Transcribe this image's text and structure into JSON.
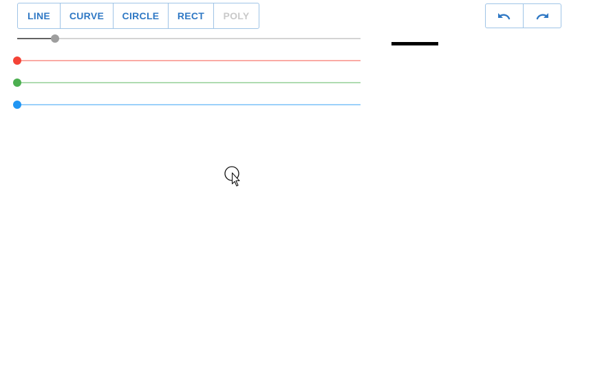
{
  "toolbar": {
    "tools": [
      {
        "key": "line",
        "label": "LINE",
        "enabled": true
      },
      {
        "key": "curve",
        "label": "CURVE",
        "enabled": true
      },
      {
        "key": "circle",
        "label": "CIRCLE",
        "enabled": true
      },
      {
        "key": "rect",
        "label": "RECT",
        "enabled": true
      },
      {
        "key": "poly",
        "label": "POLY",
        "enabled": false
      }
    ],
    "history": {
      "undo_icon": "undo-arrow-icon",
      "redo_icon": "redo-arrow-icon",
      "icon_color": "#2f78c4"
    }
  },
  "sliders": {
    "stroke_width": {
      "value": 0.11,
      "color": "#9e9e9e",
      "track_color": "#616161"
    },
    "red": {
      "value": 0,
      "color": "#f44336"
    },
    "green": {
      "value": 0,
      "color": "#4caf50"
    },
    "blue": {
      "value": 0,
      "color": "#2196f3"
    }
  },
  "preview": {
    "stroke_color": "#000000"
  },
  "canvas": {
    "cursor_icon": "circle-cursor-icon"
  }
}
